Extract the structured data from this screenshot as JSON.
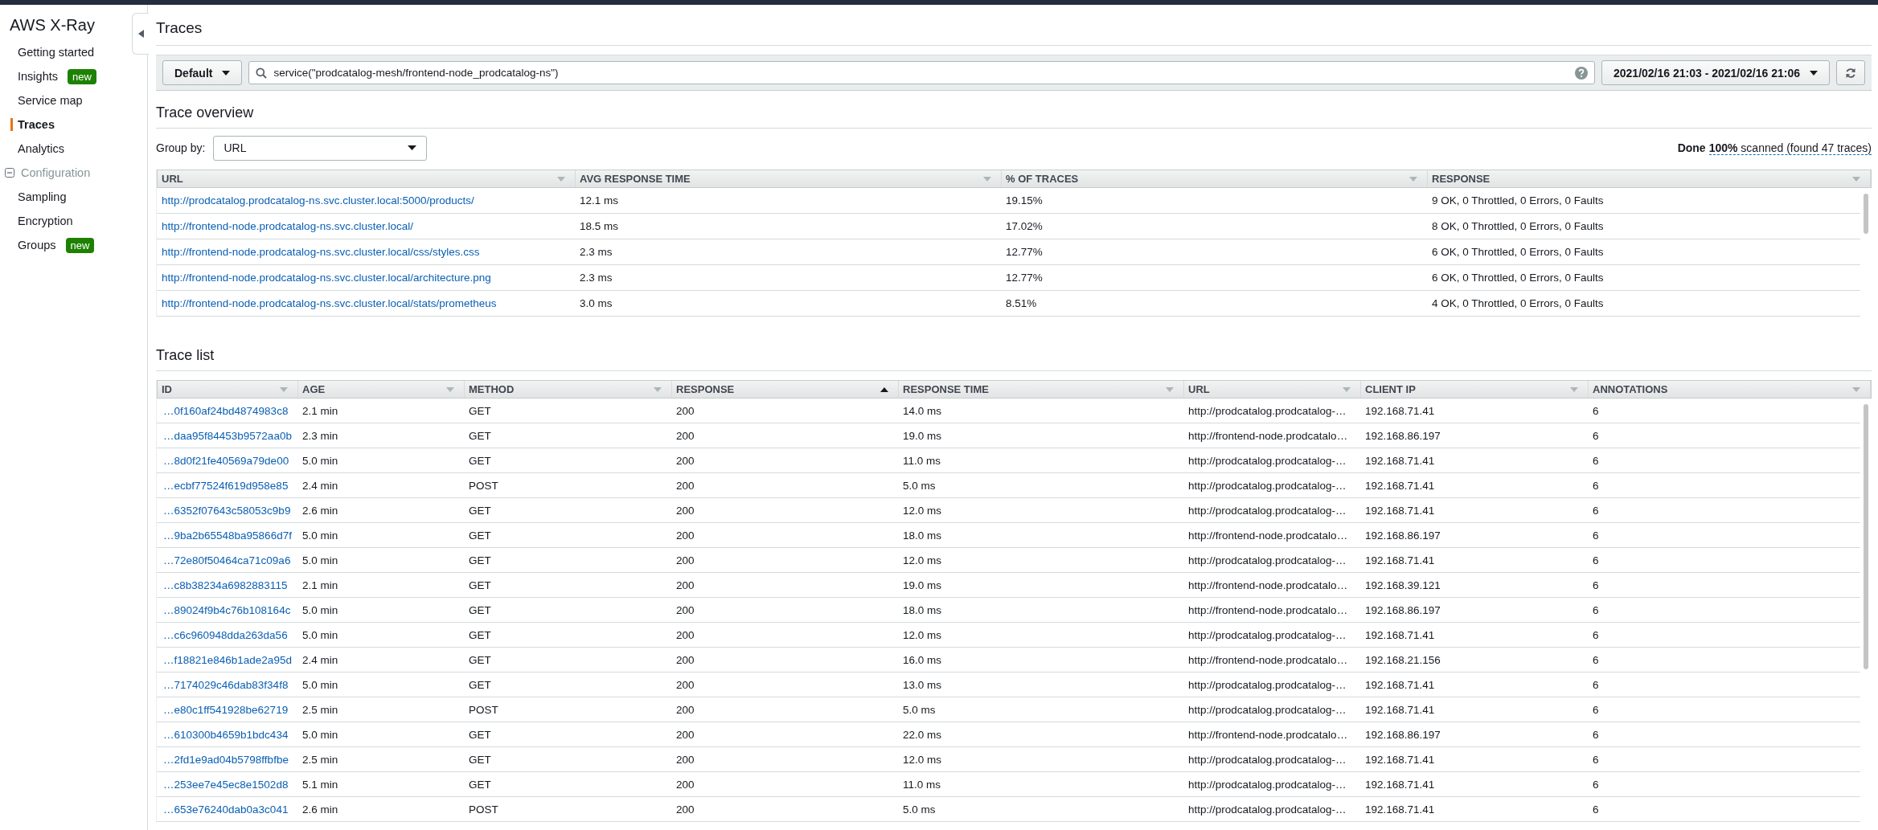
{
  "sidebar": {
    "title": "AWS X-Ray",
    "items": [
      {
        "label": "Getting started",
        "selected": false
      },
      {
        "label": "Insights",
        "badge": "new",
        "selected": false
      },
      {
        "label": "Service map",
        "selected": false
      },
      {
        "label": "Traces",
        "selected": true
      },
      {
        "label": "Analytics",
        "selected": false
      },
      {
        "label": "Configuration",
        "kind": "section",
        "expanded": true,
        "selected": false,
        "children": [
          {
            "label": "Sampling",
            "selected": false
          },
          {
            "label": "Encryption",
            "selected": false
          },
          {
            "label": "Groups",
            "badge": "new",
            "selected": false
          }
        ]
      }
    ]
  },
  "page": {
    "title": "Traces"
  },
  "query_bar": {
    "preset": "Default",
    "query": "service(\"prodcatalog-mesh/frontend-node_prodcatalog-ns\")",
    "time_range": "2021/02/16 21:03 - 2021/02/16 21:06"
  },
  "trace_overview": {
    "title": "Trace overview",
    "group_by_label": "Group by:",
    "group_by": "URL",
    "scan_state": "Done",
    "scan_progress": "**100%** scanned (found 47 traces)",
    "columns": [
      {
        "label": "URL",
        "sorted": false
      },
      {
        "label": "AVG RESPONSE TIME",
        "sorted": false
      },
      {
        "label": "% OF TRACES",
        "sorted": false
      },
      {
        "label": "RESPONSE",
        "sorted": false
      }
    ],
    "rows": [
      [
        "http://prodcatalog.prodcatalog-ns.svc.cluster.local:5000/products/",
        "12.1 ms",
        "19.15%",
        "9 OK, 0 Throttled, 0 Errors, 0 Faults"
      ],
      [
        "http://frontend-node.prodcatalog-ns.svc.cluster.local/",
        "18.5 ms",
        "17.02%",
        "8 OK, 0 Throttled, 0 Errors, 0 Faults"
      ],
      [
        "http://frontend-node.prodcatalog-ns.svc.cluster.local/css/styles.css",
        "2.3 ms",
        "12.77%",
        "6 OK, 0 Throttled, 0 Errors, 0 Faults"
      ],
      [
        "http://frontend-node.prodcatalog-ns.svc.cluster.local/architecture.png",
        "2.3 ms",
        "12.77%",
        "6 OK, 0 Throttled, 0 Errors, 0 Faults"
      ],
      [
        "http://frontend-node.prodcatalog-ns.svc.cluster.local/stats/prometheus",
        "3.0 ms",
        "8.51%",
        "4 OK, 0 Throttled, 0 Errors, 0 Faults"
      ]
    ]
  },
  "trace_list": {
    "title": "Trace list",
    "columns": [
      {
        "label": "ID",
        "sorted": false
      },
      {
        "label": "AGE",
        "sorted": false
      },
      {
        "label": "METHOD",
        "sorted": false
      },
      {
        "label": "RESPONSE",
        "sorted": true
      },
      {
        "label": "RESPONSE TIME",
        "sorted": false
      },
      {
        "label": "URL",
        "sorted": false
      },
      {
        "label": "CLIENT IP",
        "sorted": false
      },
      {
        "label": "ANNOTATIONS",
        "sorted": false
      }
    ],
    "rows": [
      [
        "…0f160af24bd4874983c8",
        "2.1 min",
        "GET",
        "200",
        "14.0 ms",
        "http://prodcatalog.prodcatalog-…",
        "192.168.71.41",
        "6"
      ],
      [
        "…daa95f84453b9572aa0b",
        "2.3 min",
        "GET",
        "200",
        "19.0 ms",
        "http://frontend-node.prodcatalo…",
        "192.168.86.197",
        "6"
      ],
      [
        "…8d0f21fe40569a79de00",
        "5.0 min",
        "GET",
        "200",
        "11.0 ms",
        "http://prodcatalog.prodcatalog-…",
        "192.168.71.41",
        "6"
      ],
      [
        "…ecbf77524f619d958e85",
        "2.4 min",
        "POST",
        "200",
        "5.0 ms",
        "http://prodcatalog.prodcatalog-…",
        "192.168.71.41",
        "6"
      ],
      [
        "…6352f07643c58053c9b9",
        "2.6 min",
        "GET",
        "200",
        "12.0 ms",
        "http://prodcatalog.prodcatalog-…",
        "192.168.71.41",
        "6"
      ],
      [
        "…9ba2b65548ba95866d7f",
        "5.0 min",
        "GET",
        "200",
        "18.0 ms",
        "http://frontend-node.prodcatalo…",
        "192.168.86.197",
        "6"
      ],
      [
        "…72e80f50464ca71c09a6",
        "5.0 min",
        "GET",
        "200",
        "12.0 ms",
        "http://prodcatalog.prodcatalog-…",
        "192.168.71.41",
        "6"
      ],
      [
        "…c8b38234a6982883115",
        "2.1 min",
        "GET",
        "200",
        "19.0 ms",
        "http://frontend-node.prodcatalo…",
        "192.168.39.121",
        "6"
      ],
      [
        "…89024f9b4c76b108164c",
        "5.0 min",
        "GET",
        "200",
        "18.0 ms",
        "http://frontend-node.prodcatalo…",
        "192.168.86.197",
        "6"
      ],
      [
        "…c6c960948dda263da56",
        "5.0 min",
        "GET",
        "200",
        "12.0 ms",
        "http://prodcatalog.prodcatalog-…",
        "192.168.71.41",
        "6"
      ],
      [
        "…f18821e846b1ade2a95d",
        "2.4 min",
        "GET",
        "200",
        "16.0 ms",
        "http://frontend-node.prodcatalo…",
        "192.168.21.156",
        "6"
      ],
      [
        "…7174029c46dab83f34f8",
        "5.0 min",
        "GET",
        "200",
        "13.0 ms",
        "http://prodcatalog.prodcatalog-…",
        "192.168.71.41",
        "6"
      ],
      [
        "…e80c1ff541928be62719",
        "2.5 min",
        "POST",
        "200",
        "5.0 ms",
        "http://prodcatalog.prodcatalog-…",
        "192.168.71.41",
        "6"
      ],
      [
        "…610300b4659b1bdc434",
        "5.0 min",
        "GET",
        "200",
        "22.0 ms",
        "http://frontend-node.prodcatalo…",
        "192.168.86.197",
        "6"
      ],
      [
        "…2fd1e9ad04b5798ffbfbe",
        "2.5 min",
        "GET",
        "200",
        "12.0 ms",
        "http://prodcatalog.prodcatalog-…",
        "192.168.71.41",
        "6"
      ],
      [
        "…253ee7e45ec8e1502d8",
        "5.1 min",
        "GET",
        "200",
        "11.0 ms",
        "http://prodcatalog.prodcatalog-…",
        "192.168.71.41",
        "6"
      ],
      [
        "…653e76240dab0a3c041",
        "2.6 min",
        "POST",
        "200",
        "5.0 ms",
        "http://prodcatalog.prodcatalog-…",
        "192.168.71.41",
        "6"
      ]
    ]
  }
}
